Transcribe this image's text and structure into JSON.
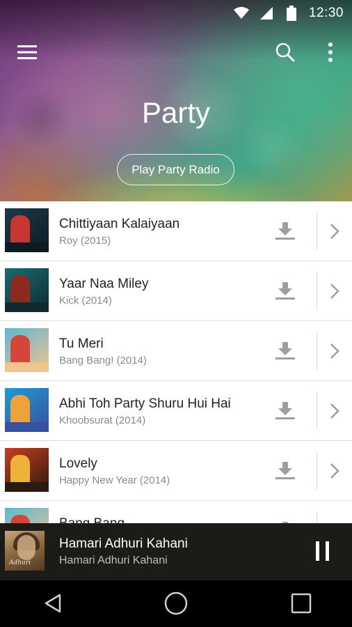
{
  "status_bar": {
    "time": "12:30",
    "icons": [
      "wifi-icon",
      "signal-icon",
      "battery-icon"
    ]
  },
  "app_bar": {
    "icons": [
      "menu-icon",
      "search-icon",
      "more-vert-icon"
    ]
  },
  "hero": {
    "title": "Party",
    "radio_button_label": "Play Party Radio"
  },
  "songs": [
    {
      "title": "Chittiyaan Kalaiyaan",
      "subtitle": "Roy (2015)",
      "art_colors": [
        "#1d3a4a",
        "#c7372f",
        "#0e1a22"
      ]
    },
    {
      "title": "Yaar Naa Miley",
      "subtitle": "Kick (2014)",
      "art_colors": [
        "#1a6b76",
        "#8c2a20",
        "#0f2b30"
      ]
    },
    {
      "title": "Tu Meri",
      "subtitle": "Bang Bang! (2014)",
      "art_colors": [
        "#5fb6d2",
        "#d6453a",
        "#f2c48d"
      ]
    },
    {
      "title": "Abhi Toh Party Shuru Hui Hai",
      "subtitle": "Khoobsurat (2014)",
      "art_colors": [
        "#1e9bd0",
        "#f0a23a",
        "#3b4fa0"
      ]
    },
    {
      "title": "Lovely",
      "subtitle": "Happy New Year (2014)",
      "art_colors": [
        "#c8401e",
        "#f0b13b",
        "#2a1a10"
      ]
    },
    {
      "title": "Bang Bang",
      "subtitle": "",
      "art_colors": [
        "#5fb6d2",
        "#d6453a",
        "#f2c48d"
      ]
    }
  ],
  "now_playing": {
    "title": "Hamari Adhuri Kahani",
    "subtitle": "Hamari Adhuri Kahani",
    "art_caption": "Adhuri",
    "state": "playing"
  },
  "nav_bar": {
    "icons": [
      "back-icon",
      "home-icon",
      "recents-icon"
    ]
  },
  "colors": {
    "now_playing_bg": "#1d1b17",
    "divider": "#dcdcdc",
    "subtitle_text": "#8a8a8a",
    "icon_gray": "#9e9e9e"
  }
}
